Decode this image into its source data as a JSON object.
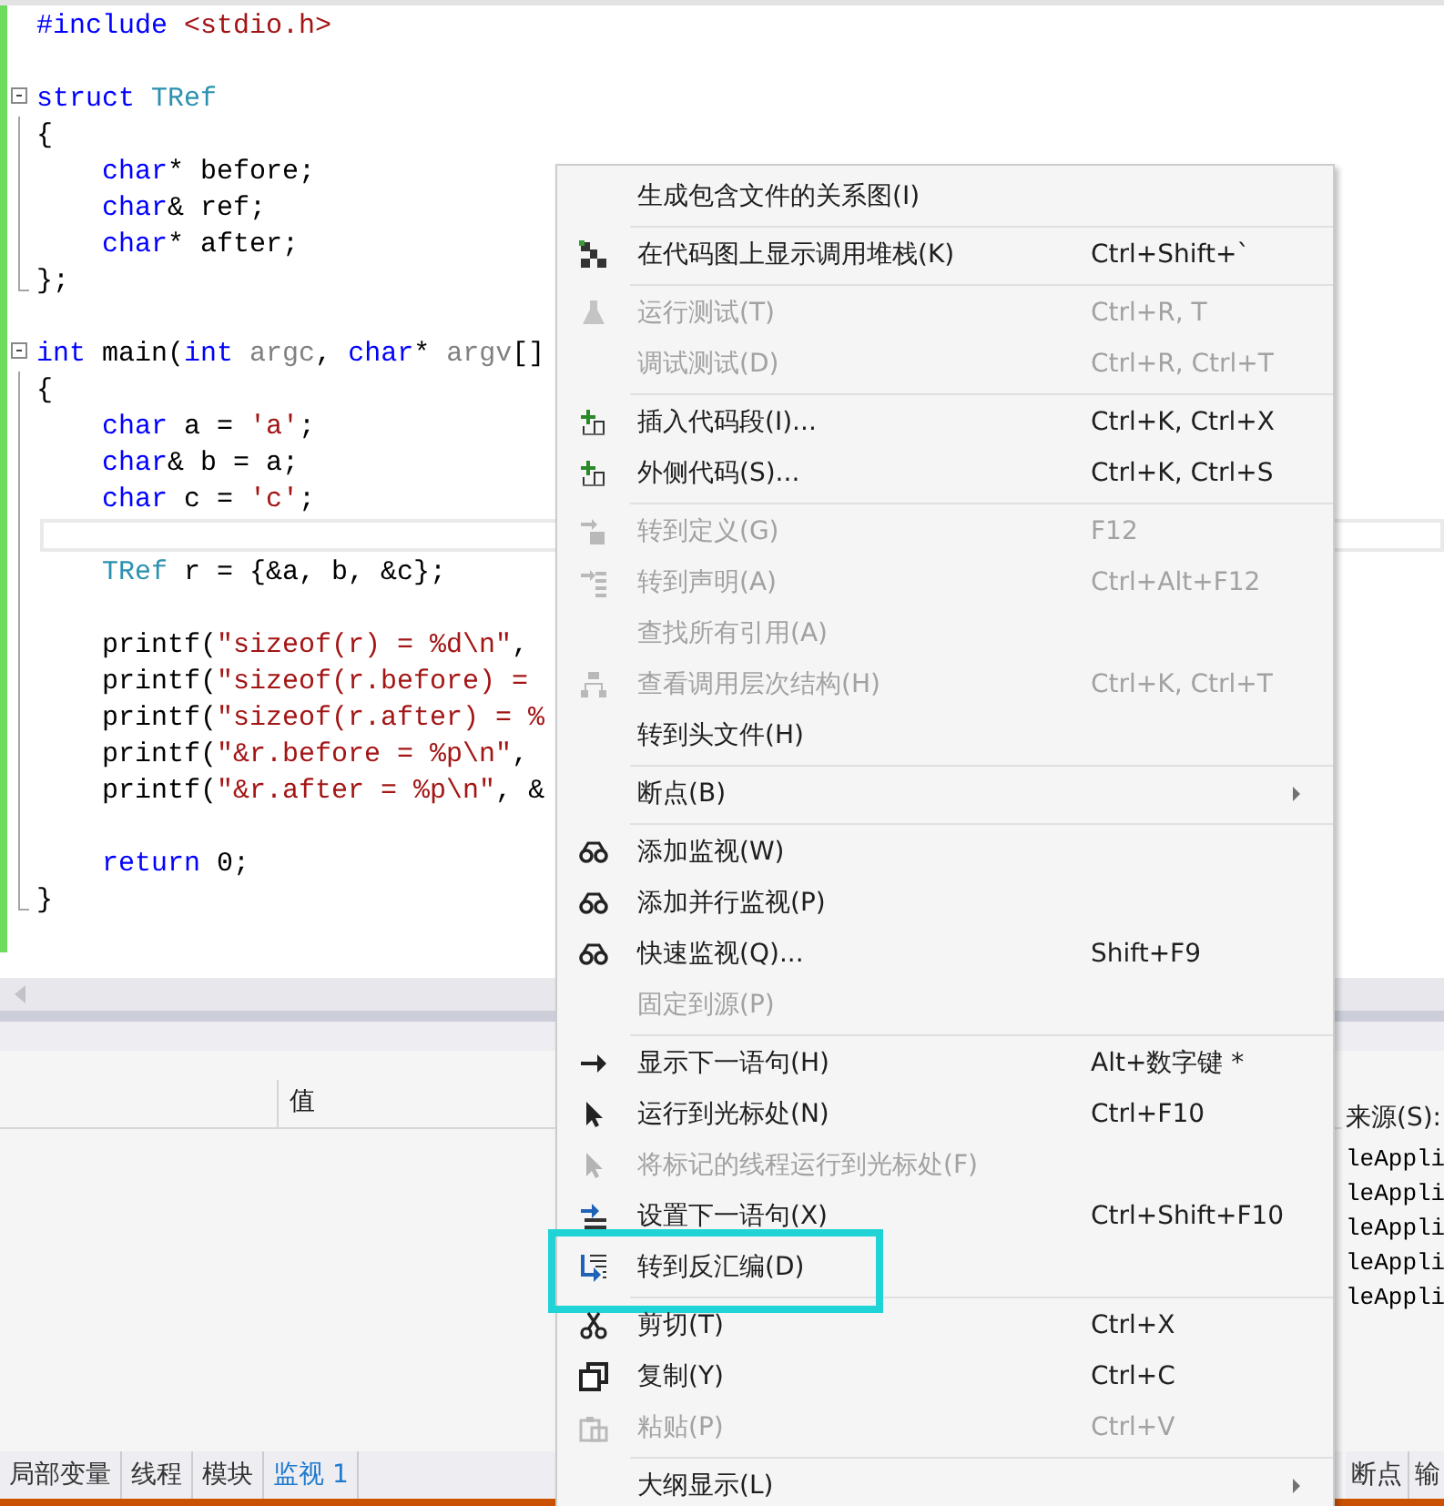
{
  "editor": {
    "lines": [
      {
        "kind": "plain",
        "current": false,
        "tokens": [
          {
            "kind": "kw",
            "t": "#include"
          },
          {
            "kind": "str",
            "t": " <stdio.h>"
          }
        ]
      },
      {
        "kind": "plain",
        "current": false
      },
      {
        "kind": "fold_start",
        "current": false,
        "tokens": [
          {
            "kind": "kw",
            "t": "struct"
          },
          {
            "kind": "type",
            "t": " TRef"
          }
        ]
      },
      {
        "kind": "fold_body",
        "current": false,
        "tokens": [
          {
            "kind": "plain",
            "t": "{"
          }
        ]
      },
      {
        "kind": "fold_body",
        "current": false,
        "tokens": [
          {
            "kind": "kw",
            "t": "    char"
          },
          {
            "kind": "plain",
            "t": "* before;"
          }
        ]
      },
      {
        "kind": "fold_body",
        "current": false,
        "tokens": [
          {
            "kind": "kw",
            "t": "    char"
          },
          {
            "kind": "plain",
            "t": "& ref;"
          }
        ]
      },
      {
        "kind": "fold_body",
        "current": false,
        "tokens": [
          {
            "kind": "kw",
            "t": "    char"
          },
          {
            "kind": "plain",
            "t": "* after;"
          }
        ]
      },
      {
        "kind": "fold_end",
        "current": false,
        "tokens": [
          {
            "kind": "plain",
            "t": "};"
          }
        ]
      },
      {
        "kind": "plain",
        "current": false
      },
      {
        "kind": "fold_start",
        "current": false,
        "tokens": [
          {
            "kind": "kw",
            "t": "int"
          },
          {
            "kind": "plain",
            "t": " main("
          },
          {
            "kind": "kw",
            "t": "int"
          },
          {
            "kind": "param",
            "t": " argc"
          },
          {
            "kind": "plain",
            "t": ", "
          },
          {
            "kind": "kw",
            "t": "char"
          },
          {
            "kind": "plain",
            "t": "* "
          },
          {
            "kind": "param",
            "t": "argv"
          },
          {
            "kind": "plain",
            "t": "[]"
          }
        ]
      },
      {
        "kind": "fold_body",
        "current": false,
        "tokens": [
          {
            "kind": "plain",
            "t": "{"
          }
        ]
      },
      {
        "kind": "fold_body",
        "current": false,
        "tokens": [
          {
            "kind": "kw",
            "t": "    char"
          },
          {
            "kind": "plain",
            "t": " a = "
          },
          {
            "kind": "str",
            "t": "'a'"
          },
          {
            "kind": "plain",
            "t": ";"
          }
        ]
      },
      {
        "kind": "fold_body",
        "current": false,
        "tokens": [
          {
            "kind": "kw",
            "t": "    char"
          },
          {
            "kind": "plain",
            "t": "& b = a;"
          }
        ]
      },
      {
        "kind": "fold_body",
        "current": false,
        "tokens": [
          {
            "kind": "kw",
            "t": "    char"
          },
          {
            "kind": "plain",
            "t": " c = "
          },
          {
            "kind": "str",
            "t": "'c'"
          },
          {
            "kind": "plain",
            "t": ";"
          }
        ]
      },
      {
        "kind": "fold_body",
        "current": true
      },
      {
        "kind": "fold_body",
        "current": false,
        "tokens": [
          {
            "kind": "type",
            "t": "    TRef"
          },
          {
            "kind": "plain",
            "t": " r = {&a, b, &c};"
          }
        ]
      },
      {
        "kind": "fold_body",
        "current": false
      },
      {
        "kind": "fold_body",
        "current": false,
        "tokens": [
          {
            "kind": "plain",
            "t": "    printf("
          },
          {
            "kind": "str",
            "t": "\"sizeof(r) = %d\\n\""
          },
          {
            "kind": "plain",
            "t": ","
          }
        ]
      },
      {
        "kind": "fold_body",
        "current": false,
        "tokens": [
          {
            "kind": "plain",
            "t": "    printf("
          },
          {
            "kind": "str",
            "t": "\"sizeof(r.before) ="
          }
        ]
      },
      {
        "kind": "fold_body",
        "current": false,
        "tokens": [
          {
            "kind": "plain",
            "t": "    printf("
          },
          {
            "kind": "str",
            "t": "\"sizeof(r.after) = %"
          }
        ]
      },
      {
        "kind": "fold_body",
        "current": false,
        "tokens": [
          {
            "kind": "plain",
            "t": "    printf("
          },
          {
            "kind": "str",
            "t": "\"&r.before = %p\\n\""
          },
          {
            "kind": "plain",
            "t": ","
          }
        ]
      },
      {
        "kind": "fold_body",
        "current": false,
        "tokens": [
          {
            "kind": "plain",
            "t": "    printf("
          },
          {
            "kind": "str",
            "t": "\"&r.after = %p\\n\""
          },
          {
            "kind": "plain",
            "t": ", &"
          }
        ]
      },
      {
        "kind": "fold_body",
        "current": false
      },
      {
        "kind": "fold_body",
        "current": false,
        "tokens": [
          {
            "kind": "kw",
            "t": "    return"
          },
          {
            "kind": "plain",
            "t": " 0;"
          }
        ]
      },
      {
        "kind": "fold_end",
        "current": false,
        "tokens": [
          {
            "kind": "plain",
            "t": "}"
          }
        ]
      }
    ]
  },
  "watch_panel": {
    "columns": [
      {
        "label": "值"
      }
    ],
    "tabs": [
      {
        "label": "局部变量",
        "selected": false
      },
      {
        "label": "线程",
        "selected": false
      },
      {
        "label": "模块",
        "selected": false
      },
      {
        "label": "监视 1",
        "selected": true
      }
    ]
  },
  "side_panel": {
    "label": "来源(S):",
    "lines": [
      "leAppli",
      "leAppli",
      "leAppli",
      "leAppli",
      "leAppli"
    ],
    "tabs": [
      {
        "label": "断点",
        "selected": false
      },
      {
        "label": "输",
        "selected": false
      }
    ]
  },
  "context_menu": {
    "groups": [
      [
        {
          "label": "生成包含文件的关系图(I)",
          "disabled": false,
          "highlighted": false
        }
      ],
      [
        {
          "label": "在代码图上显示调用堆栈(K)",
          "shortcut": "Ctrl+Shift+`",
          "disabled": false,
          "highlighted": false
        }
      ],
      [
        {
          "label": "运行测试(T)",
          "shortcut": "Ctrl+R, T",
          "disabled": true,
          "highlighted": false
        },
        {
          "label": "调试测试(D)",
          "shortcut": "Ctrl+R, Ctrl+T",
          "disabled": true,
          "highlighted": false
        }
      ],
      [
        {
          "label": "插入代码段(I)...",
          "shortcut": "Ctrl+K, Ctrl+X",
          "disabled": false,
          "highlighted": false
        },
        {
          "label": "外侧代码(S)...",
          "shortcut": "Ctrl+K, Ctrl+S",
          "disabled": false,
          "highlighted": false
        }
      ],
      [
        {
          "label": "转到定义(G)",
          "shortcut": "F12",
          "disabled": true,
          "highlighted": false
        },
        {
          "label": "转到声明(A)",
          "shortcut": "Ctrl+Alt+F12",
          "disabled": true,
          "highlighted": false
        },
        {
          "label": "查找所有引用(A)",
          "disabled": true,
          "highlighted": false
        },
        {
          "label": "查看调用层次结构(H)",
          "shortcut": "Ctrl+K, Ctrl+T",
          "disabled": true,
          "highlighted": false
        },
        {
          "label": "转到头文件(H)",
          "disabled": false,
          "highlighted": false
        }
      ],
      [
        {
          "label": "断点(B)",
          "disabled": false,
          "highlighted": false,
          "submenu": true
        }
      ],
      [
        {
          "label": "添加监视(W)",
          "disabled": false,
          "highlighted": false
        },
        {
          "label": "添加并行监视(P)",
          "disabled": false,
          "highlighted": false
        },
        {
          "label": "快速监视(Q)...",
          "shortcut": "Shift+F9",
          "disabled": false,
          "highlighted": false
        },
        {
          "label": "固定到源(P)",
          "disabled": true,
          "highlighted": false
        }
      ],
      [
        {
          "label": "显示下一语句(H)",
          "shortcut": "Alt+数字键 *",
          "disabled": false,
          "highlighted": false
        },
        {
          "label": "运行到光标处(N)",
          "shortcut": "Ctrl+F10",
          "disabled": false,
          "highlighted": false
        },
        {
          "label": "将标记的线程运行到光标处(F)",
          "disabled": true,
          "highlighted": false
        },
        {
          "label": "设置下一语句(X)",
          "shortcut": "Ctrl+Shift+F10",
          "disabled": false,
          "highlighted": false
        },
        {
          "label": "转到反汇编(D)",
          "disabled": false,
          "highlighted": true
        }
      ],
      [
        {
          "label": "剪切(T)",
          "shortcut": "Ctrl+X",
          "disabled": false,
          "highlighted": false
        },
        {
          "label": "复制(Y)",
          "shortcut": "Ctrl+C",
          "disabled": false,
          "highlighted": false
        },
        {
          "label": "粘贴(P)",
          "shortcut": "Ctrl+V",
          "disabled": true,
          "highlighted": false
        }
      ],
      [
        {
          "label": "大纲显示(L)",
          "disabled": false,
          "highlighted": false,
          "submenu": true
        }
      ]
    ]
  }
}
